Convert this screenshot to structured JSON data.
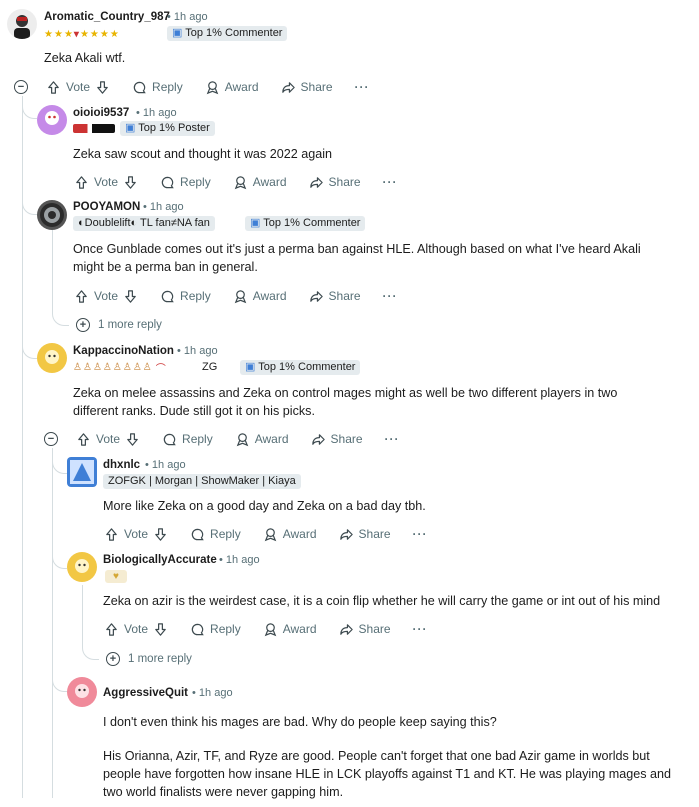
{
  "actions": {
    "vote": "Vote",
    "reply": "Reply",
    "award": "Award",
    "share": "Share",
    "more": "···"
  },
  "comments": [
    {
      "user": "Aromatic_Country_987",
      "time": "1h ago",
      "flair": "Top 1% Commenter",
      "body": "Zeka Akali wtf.",
      "avatar_color": "#e9e9e9"
    },
    {
      "user": "oioioi9537",
      "time": "1h ago",
      "flair": "Top 1% Poster",
      "body": "Zeka saw scout and thought it was 2022 again",
      "avatar_color": "#c58ae8"
    },
    {
      "user": "POOYAMON",
      "time": "1h ago",
      "flair_prefix": "Doublelift",
      "flair_mid": "TL fan≠NA fan",
      "flair": "Top 1% Commenter",
      "body_lines": [
        "Once Gunblade comes out it's just a perma ban against HLE. Although based on what I've heard Akali",
        "might be a perma ban in general."
      ],
      "avatar_color": "#9aa0a3",
      "more_replies": "1 more reply"
    },
    {
      "user": "KappaccinoNation",
      "time": "1h ago",
      "flair_mid": "ZG",
      "flair": "Top 1% Commenter",
      "body_lines": [
        "Zeka on melee assassins and Zeka on control mages might as well be two different players in two",
        "different ranks. Dude still got it on his picks."
      ],
      "avatar_color": "#f2c744"
    },
    {
      "user": "dhxnlc",
      "time": "1h ago",
      "flair": "ZOFGK | Morgan | ShowMaker | Kiaya",
      "body": "More like Zeka on a good day and Zeka on a bad day tbh.",
      "avatar_color": "#3f7fd6"
    },
    {
      "user": "BiologicallyAccurate",
      "time": "1h ago",
      "body": "Zeka on azir is the weirdest case, it is a coin flip whether he will carry the game or int out of his mind",
      "avatar_color": "#f2c744",
      "more_replies": "1 more reply"
    },
    {
      "user": "AggressiveQuit",
      "time": "1h ago",
      "body": "I don't even think his mages are bad. Why do people keep saying this?",
      "body_lines": [
        "His Orianna, Azir, TF, and Ryze are good. People can't forget that one bad Azir game in worlds but",
        "people have forgotten how insane HLE in LCK playoffs against T1 and KT. He was playing mages and",
        "two world finalists were never gapping him."
      ],
      "avatar_color": "#f08a9a"
    }
  ],
  "colors": {
    "meta": "#576f76",
    "flair_bg": "#e5ebee",
    "thread_line": "#d5dde0"
  }
}
